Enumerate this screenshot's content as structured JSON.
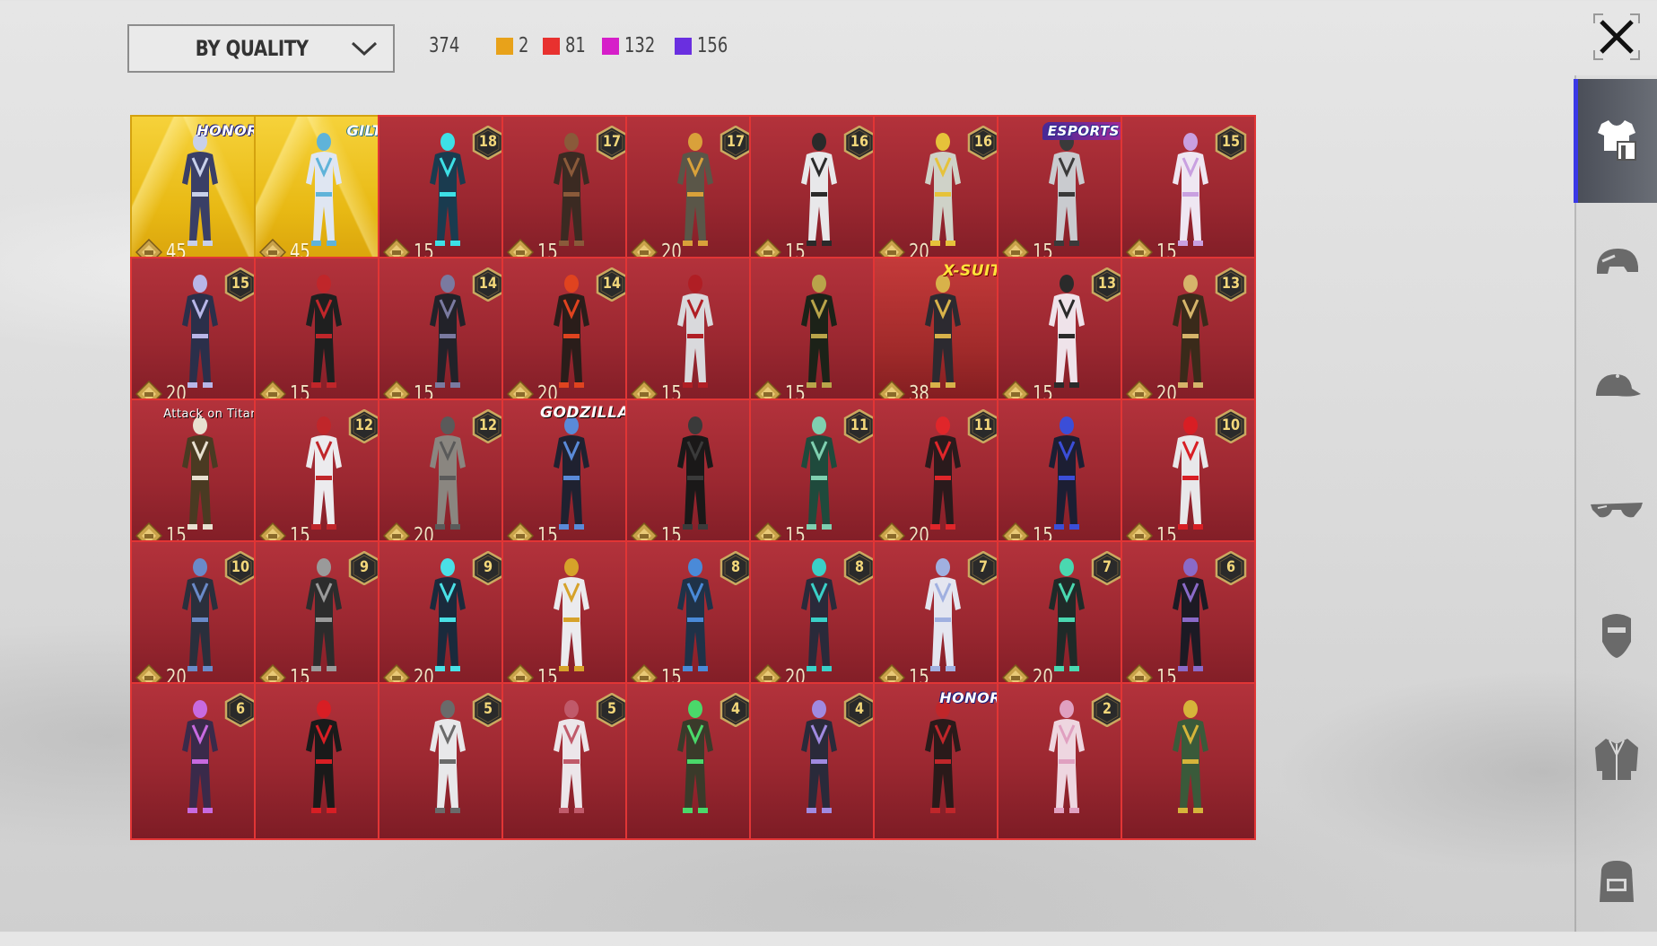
{
  "header": {
    "sort_label": "BY QUALITY",
    "total": "374",
    "quality_counts": [
      {
        "color": "#e8a21a",
        "count": "2"
      },
      {
        "color": "#e8312f",
        "count": "81"
      },
      {
        "color": "#d61ec9",
        "count": "132"
      },
      {
        "color": "#6a2fe0",
        "count": "156"
      }
    ]
  },
  "sidebar": {
    "items": [
      {
        "icon": "outfit-icon",
        "active": true
      },
      {
        "icon": "helmet-icon",
        "active": false
      },
      {
        "icon": "cap-icon",
        "active": false
      },
      {
        "icon": "glasses-icon",
        "active": false
      },
      {
        "icon": "mask-icon",
        "active": false
      },
      {
        "icon": "jacket-icon",
        "active": false
      },
      {
        "icon": "backpack-icon",
        "active": false
      }
    ]
  },
  "items": [
    {
      "quality": "legendary",
      "brand": "HONOR",
      "level": "",
      "price": "45",
      "outfit": "#3a3f66",
      "accent": "#c8d0ea"
    },
    {
      "quality": "legendary",
      "brand": "GILT",
      "level": "",
      "price": "45",
      "outfit": "#dfe6f2",
      "accent": "#5fb3d9"
    },
    {
      "quality": "red",
      "brand": "",
      "level": "18",
      "price": "15",
      "outfit": "#1a3b4f",
      "accent": "#3de0e6"
    },
    {
      "quality": "red",
      "brand": "",
      "level": "17",
      "price": "15",
      "outfit": "#3b2a22",
      "accent": "#8a5a3a"
    },
    {
      "quality": "red",
      "brand": "",
      "level": "17",
      "price": "20",
      "outfit": "#5a5648",
      "accent": "#d9a13a"
    },
    {
      "quality": "red",
      "brand": "",
      "level": "16",
      "price": "15",
      "outfit": "#e8e8ea",
      "accent": "#2a2a2a"
    },
    {
      "quality": "red",
      "brand": "",
      "level": "16",
      "price": "20",
      "outfit": "#cfd2c8",
      "accent": "#e6c23a"
    },
    {
      "quality": "red",
      "brand": "ESPORTS",
      "level": "",
      "price": "15",
      "outfit": "#c9cbcf",
      "accent": "#3a3a3a"
    },
    {
      "quality": "red",
      "brand": "",
      "level": "15",
      "price": "15",
      "outfit": "#efe7f2",
      "accent": "#c9a0e0"
    },
    {
      "quality": "red",
      "brand": "",
      "level": "15",
      "price": "20",
      "outfit": "#2b2f4a",
      "accent": "#b8b6e8"
    },
    {
      "quality": "red",
      "brand": "",
      "level": "",
      "price": "15",
      "outfit": "#1f1f1f",
      "accent": "#c0262a"
    },
    {
      "quality": "red",
      "brand": "",
      "level": "14",
      "price": "15",
      "outfit": "#222229",
      "accent": "#7a7aa0"
    },
    {
      "quality": "red",
      "brand": "",
      "level": "14",
      "price": "20",
      "outfit": "#2a1d1a",
      "accent": "#e0431f"
    },
    {
      "quality": "red",
      "brand": "",
      "level": "",
      "price": "15",
      "outfit": "#d9d9dc",
      "accent": "#b01e24"
    },
    {
      "quality": "red",
      "brand": "",
      "level": "",
      "price": "15",
      "outfit": "#1c2218",
      "accent": "#b9a44a"
    },
    {
      "quality": "xsuit",
      "brand": "X-SUIT",
      "level": "",
      "price": "38",
      "outfit": "#2c2a30",
      "accent": "#d8b24a"
    },
    {
      "quality": "red",
      "brand": "",
      "level": "13",
      "price": "15",
      "outfit": "#efe3ea",
      "accent": "#2a2a2a"
    },
    {
      "quality": "red",
      "brand": "",
      "level": "13",
      "price": "20",
      "outfit": "#3a2a1a",
      "accent": "#d6b46a"
    },
    {
      "quality": "red",
      "brand": "Attack on Titan",
      "level": "",
      "price": "15",
      "outfit": "#4a3a22",
      "accent": "#e8e0d0"
    },
    {
      "quality": "red",
      "brand": "",
      "level": "12",
      "price": "15",
      "outfit": "#ecebee",
      "accent": "#c0262a"
    },
    {
      "quality": "red",
      "brand": "",
      "level": "12",
      "price": "20",
      "outfit": "#8a8680",
      "accent": "#5a5a5a"
    },
    {
      "quality": "red",
      "brand": "GODZILLA",
      "level": "",
      "price": "15",
      "outfit": "#1f2130",
      "accent": "#5a8ad8"
    },
    {
      "quality": "red",
      "brand": "",
      "level": "",
      "price": "15",
      "outfit": "#1a1818",
      "accent": "#3a3a3a"
    },
    {
      "quality": "red",
      "brand": "",
      "level": "11",
      "price": "15",
      "outfit": "#1f4a3c",
      "accent": "#7fd0b0"
    },
    {
      "quality": "red",
      "brand": "",
      "level": "11",
      "price": "20",
      "outfit": "#2a1a1c",
      "accent": "#e0262a"
    },
    {
      "quality": "red",
      "brand": "",
      "level": "",
      "price": "15",
      "outfit": "#1c1e33",
      "accent": "#3b4ed8"
    },
    {
      "quality": "red",
      "brand": "",
      "level": "10",
      "price": "15",
      "outfit": "#e8e8ea",
      "accent": "#d81e24"
    },
    {
      "quality": "red",
      "brand": "",
      "level": "10",
      "price": "20",
      "outfit": "#2a2f3c",
      "accent": "#6a8ac8"
    },
    {
      "quality": "red",
      "brand": "",
      "level": "9",
      "price": "15",
      "outfit": "#2c2c2c",
      "accent": "#9a9a9a"
    },
    {
      "quality": "red",
      "brand": "",
      "level": "9",
      "price": "20",
      "outfit": "#1a2a3c",
      "accent": "#4ae0e6"
    },
    {
      "quality": "red",
      "brand": "",
      "level": "",
      "price": "15",
      "outfit": "#ebebee",
      "accent": "#d6a22a"
    },
    {
      "quality": "red",
      "brand": "",
      "level": "8",
      "price": "15",
      "outfit": "#1f3248",
      "accent": "#4a8ad8"
    },
    {
      "quality": "red",
      "brand": "",
      "level": "8",
      "price": "20",
      "outfit": "#2a2a3a",
      "accent": "#3ad0c8"
    },
    {
      "quality": "red",
      "brand": "",
      "level": "7",
      "price": "15",
      "outfit": "#e4e6f0",
      "accent": "#a0b0e0"
    },
    {
      "quality": "red",
      "brand": "",
      "level": "7",
      "price": "20",
      "outfit": "#1f2a28",
      "accent": "#4ad8b0"
    },
    {
      "quality": "red",
      "brand": "",
      "level": "6",
      "price": "15",
      "outfit": "#1c1a24",
      "accent": "#8a6ac8"
    },
    {
      "quality": "red",
      "brand": "",
      "level": "6",
      "price": "",
      "outfit": "#3a2a4a",
      "accent": "#c86ae0"
    },
    {
      "quality": "red",
      "brand": "",
      "level": "",
      "price": "",
      "outfit": "#1a1a1a",
      "accent": "#d81e24"
    },
    {
      "quality": "red",
      "brand": "",
      "level": "5",
      "price": "",
      "outfit": "#e8e8ea",
      "accent": "#6a6a6a"
    },
    {
      "quality": "red",
      "brand": "",
      "level": "5",
      "price": "",
      "outfit": "#ece6ea",
      "accent": "#c05a6a"
    },
    {
      "quality": "red",
      "brand": "",
      "level": "4",
      "price": "",
      "outfit": "#3a3a2a",
      "accent": "#4ad86a"
    },
    {
      "quality": "red",
      "brand": "",
      "level": "4",
      "price": "",
      "outfit": "#2a2a3a",
      "accent": "#a08ae0"
    },
    {
      "quality": "red",
      "brand": "HONOR",
      "level": "",
      "price": "",
      "outfit": "#2a1a1a",
      "accent": "#c0262a"
    },
    {
      "quality": "red",
      "brand": "",
      "level": "2",
      "price": "",
      "outfit": "#eed6e0",
      "accent": "#e0a0c0"
    },
    {
      "quality": "red",
      "brand": "",
      "level": "",
      "price": "",
      "outfit": "#3a5a3a",
      "accent": "#d6b43a"
    }
  ]
}
